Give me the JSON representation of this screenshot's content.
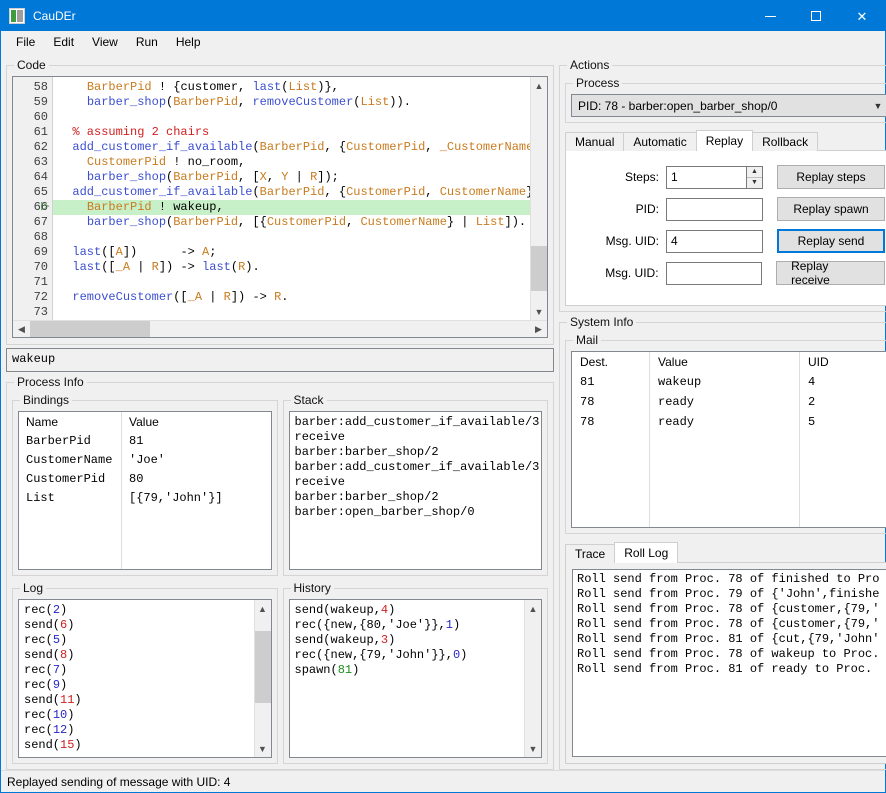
{
  "window": {
    "title": "CauDEr",
    "icon": "app-icon",
    "minimize": "–",
    "maximize": "□",
    "close": "✕"
  },
  "menubar": {
    "items": [
      "File",
      "Edit",
      "View",
      "Run",
      "Help"
    ]
  },
  "code_panel": {
    "title": "Code",
    "current_line": 66,
    "lines": [
      {
        "num": "58",
        "tokens": [
          {
            "t": "    ",
            "c": "pun"
          },
          {
            "t": "BarberPid",
            "c": "var"
          },
          {
            "t": " ! {",
            "c": "pun"
          },
          {
            "t": "customer",
            "c": "atom"
          },
          {
            "t": ", ",
            "c": "pun"
          },
          {
            "t": "last",
            "c": "fn"
          },
          {
            "t": "(",
            "c": "pun"
          },
          {
            "t": "List",
            "c": "var"
          },
          {
            "t": ")},",
            "c": "pun"
          }
        ]
      },
      {
        "num": "59",
        "tokens": [
          {
            "t": "    ",
            "c": "pun"
          },
          {
            "t": "barber_shop",
            "c": "fn"
          },
          {
            "t": "(",
            "c": "pun"
          },
          {
            "t": "BarberPid",
            "c": "var"
          },
          {
            "t": ", ",
            "c": "pun"
          },
          {
            "t": "removeCustomer",
            "c": "fn"
          },
          {
            "t": "(",
            "c": "pun"
          },
          {
            "t": "List",
            "c": "var"
          },
          {
            "t": ")).",
            "c": "pun"
          }
        ]
      },
      {
        "num": "60",
        "tokens": []
      },
      {
        "num": "61",
        "tokens": [
          {
            "t": "  % assuming 2 chairs",
            "c": "com"
          }
        ]
      },
      {
        "num": "62",
        "tokens": [
          {
            "t": "  ",
            "c": "pun"
          },
          {
            "t": "add_customer_if_available",
            "c": "fn"
          },
          {
            "t": "(",
            "c": "pun"
          },
          {
            "t": "BarberPid",
            "c": "var"
          },
          {
            "t": ", {",
            "c": "pun"
          },
          {
            "t": "CustomerPid",
            "c": "var"
          },
          {
            "t": ", ",
            "c": "pun"
          },
          {
            "t": "_CustomerName",
            "c": "var"
          },
          {
            "t": "}, [",
            "c": "pun"
          }
        ]
      },
      {
        "num": "63",
        "tokens": [
          {
            "t": "    ",
            "c": "pun"
          },
          {
            "t": "CustomerPid",
            "c": "var"
          },
          {
            "t": " ! ",
            "c": "pun"
          },
          {
            "t": "no_room",
            "c": "atom"
          },
          {
            "t": ",",
            "c": "pun"
          }
        ]
      },
      {
        "num": "64",
        "tokens": [
          {
            "t": "    ",
            "c": "pun"
          },
          {
            "t": "barber_shop",
            "c": "fn"
          },
          {
            "t": "(",
            "c": "pun"
          },
          {
            "t": "BarberPid",
            "c": "var"
          },
          {
            "t": ", [",
            "c": "pun"
          },
          {
            "t": "X",
            "c": "var"
          },
          {
            "t": ", ",
            "c": "pun"
          },
          {
            "t": "Y",
            "c": "var"
          },
          {
            "t": " | ",
            "c": "pun"
          },
          {
            "t": "R",
            "c": "var"
          },
          {
            "t": "]);",
            "c": "pun"
          }
        ]
      },
      {
        "num": "65",
        "tokens": [
          {
            "t": "  ",
            "c": "pun"
          },
          {
            "t": "add_customer_if_available",
            "c": "fn"
          },
          {
            "t": "(",
            "c": "pun"
          },
          {
            "t": "BarberPid",
            "c": "var"
          },
          {
            "t": ", {",
            "c": "pun"
          },
          {
            "t": "CustomerPid",
            "c": "var"
          },
          {
            "t": ", ",
            "c": "pun"
          },
          {
            "t": "CustomerName",
            "c": "var"
          },
          {
            "t": "}, ",
            "c": "pun"
          },
          {
            "t": "Li",
            "c": "var"
          }
        ]
      },
      {
        "num": "66",
        "highlight": true,
        "marker": true,
        "tokens": [
          {
            "t": "    ",
            "c": "pun"
          },
          {
            "t": "BarberPid",
            "c": "var"
          },
          {
            "t": " ! ",
            "c": "pun"
          },
          {
            "t": "wakeup",
            "c": "atom"
          },
          {
            "t": ",",
            "c": "pun"
          }
        ]
      },
      {
        "num": "67",
        "tokens": [
          {
            "t": "    ",
            "c": "pun"
          },
          {
            "t": "barber_shop",
            "c": "fn"
          },
          {
            "t": "(",
            "c": "pun"
          },
          {
            "t": "BarberPid",
            "c": "var"
          },
          {
            "t": ", [{",
            "c": "pun"
          },
          {
            "t": "CustomerPid",
            "c": "var"
          },
          {
            "t": ", ",
            "c": "pun"
          },
          {
            "t": "CustomerName",
            "c": "var"
          },
          {
            "t": "} | ",
            "c": "pun"
          },
          {
            "t": "List",
            "c": "var"
          },
          {
            "t": "]).",
            "c": "pun"
          }
        ]
      },
      {
        "num": "68",
        "tokens": []
      },
      {
        "num": "69",
        "tokens": [
          {
            "t": "  ",
            "c": "pun"
          },
          {
            "t": "last",
            "c": "fn"
          },
          {
            "t": "([",
            "c": "pun"
          },
          {
            "t": "A",
            "c": "var"
          },
          {
            "t": "])      -> ",
            "c": "pun"
          },
          {
            "t": "A",
            "c": "var"
          },
          {
            "t": ";",
            "c": "pun"
          }
        ]
      },
      {
        "num": "70",
        "tokens": [
          {
            "t": "  ",
            "c": "pun"
          },
          {
            "t": "last",
            "c": "fn"
          },
          {
            "t": "([",
            "c": "pun"
          },
          {
            "t": "_A",
            "c": "var"
          },
          {
            "t": " | ",
            "c": "pun"
          },
          {
            "t": "R",
            "c": "var"
          },
          {
            "t": "]) -> ",
            "c": "pun"
          },
          {
            "t": "last",
            "c": "fn"
          },
          {
            "t": "(",
            "c": "pun"
          },
          {
            "t": "R",
            "c": "var"
          },
          {
            "t": ").",
            "c": "pun"
          }
        ]
      },
      {
        "num": "71",
        "tokens": []
      },
      {
        "num": "72",
        "tokens": [
          {
            "t": "  ",
            "c": "pun"
          },
          {
            "t": "removeCustomer",
            "c": "fn"
          },
          {
            "t": "([",
            "c": "pun"
          },
          {
            "t": "_A",
            "c": "var"
          },
          {
            "t": " | ",
            "c": "pun"
          },
          {
            "t": "R",
            "c": "var"
          },
          {
            "t": "]) -> ",
            "c": "pun"
          },
          {
            "t": "R",
            "c": "var"
          },
          {
            "t": ".",
            "c": "pun"
          }
        ]
      },
      {
        "num": "73",
        "tokens": []
      }
    ]
  },
  "expression": {
    "value": "wakeup"
  },
  "process_info": {
    "title": "Process Info",
    "bindings": {
      "title": "Bindings",
      "columns": [
        "Name",
        "Value"
      ],
      "rows": [
        [
          "BarberPid",
          "81"
        ],
        [
          "CustomerName",
          "'Joe'"
        ],
        [
          "CustomerPid",
          "80"
        ],
        [
          "List",
          "[{79,'John'}]"
        ]
      ]
    },
    "stack": {
      "title": "Stack",
      "lines": [
        "barber:add_customer_if_available/3",
        "receive",
        "barber:barber_shop/2",
        "barber:add_customer_if_available/3",
        "receive",
        "barber:barber_shop/2",
        "barber:open_barber_shop/0"
      ]
    },
    "log": {
      "title": "Log",
      "entries": [
        {
          "kind": "rec",
          "arg": "2"
        },
        {
          "kind": "send",
          "arg": "6"
        },
        {
          "kind": "rec",
          "arg": "5"
        },
        {
          "kind": "send",
          "arg": "8"
        },
        {
          "kind": "rec",
          "arg": "7"
        },
        {
          "kind": "rec",
          "arg": "9"
        },
        {
          "kind": "send",
          "arg": "11"
        },
        {
          "kind": "rec",
          "arg": "10"
        },
        {
          "kind": "rec",
          "arg": "12"
        },
        {
          "kind": "send",
          "arg": "15"
        }
      ]
    },
    "history": {
      "title": "History",
      "entries": [
        {
          "kind": "send",
          "pre": "send(wakeup,",
          "arg": "4",
          "post": ")"
        },
        {
          "kind": "rec",
          "pre": "rec({new,{80,'Joe'}},",
          "arg": "1",
          "post": ")"
        },
        {
          "kind": "send",
          "pre": "send(wakeup,",
          "arg": "3",
          "post": ")"
        },
        {
          "kind": "rec",
          "pre": "rec({new,{79,'John'}},",
          "arg": "0",
          "post": ")"
        },
        {
          "kind": "spawn",
          "pre": "spawn(",
          "arg": "81",
          "post": ")"
        }
      ]
    }
  },
  "actions": {
    "title": "Actions",
    "process": {
      "title": "Process",
      "selected": "PID: 78 - barber:open_barber_shop/0",
      "arrow": "⌄"
    },
    "tabs": [
      {
        "label": "Manual",
        "active": false
      },
      {
        "label": "Automatic",
        "active": false
      },
      {
        "label": "Replay",
        "active": true
      },
      {
        "label": "Rollback",
        "active": false
      }
    ],
    "replay": {
      "rows": [
        {
          "label": "Steps:",
          "value": "1",
          "placeholder": "",
          "spinner": true,
          "button": "Replay steps",
          "focused": false
        },
        {
          "label": "PID:",
          "value": "",
          "placeholder": "",
          "spinner": false,
          "button": "Replay spawn",
          "focused": false
        },
        {
          "label": "Msg. UID:",
          "value": "4",
          "placeholder": "",
          "spinner": false,
          "button": "Replay send",
          "focused": true
        },
        {
          "label": "Msg. UID:",
          "value": "",
          "placeholder": "",
          "spinner": false,
          "button": "Replay receive",
          "focused": false
        }
      ]
    }
  },
  "system_info": {
    "title": "System Info",
    "mail": {
      "title": "Mail",
      "columns": [
        "Dest.",
        "Value",
        "UID"
      ],
      "rows": [
        [
          "81",
          "wakeup",
          "4"
        ],
        [
          "78",
          "ready",
          "2"
        ],
        [
          "78",
          "ready",
          "5"
        ]
      ]
    },
    "log_tabs": [
      {
        "label": "Trace",
        "active": false
      },
      {
        "label": "Roll Log",
        "active": true
      }
    ],
    "roll_log": {
      "lines": [
        "Roll send from Proc. 78 of finished to Pro",
        "Roll send from Proc. 79 of {'John',finishe",
        "Roll send from Proc. 78 of {customer,{79,'",
        "Roll send from Proc. 78 of {customer,{79,'",
        "Roll send from Proc. 81 of {cut,{79,'John'",
        "Roll send from Proc. 78 of wakeup to Proc.",
        "Roll send from Proc. 81 of ready to Proc."
      ]
    }
  },
  "statusbar": {
    "text": "Replayed sending of message with UID: 4"
  },
  "colors": {
    "accent": "#0078d7",
    "highlight_line": "#c8f0c8",
    "marker": "#3d9c3d",
    "function": "#3b4fcf",
    "variable": "#c97b1e",
    "comment": "#d02020",
    "log_rec": "#2626c8",
    "log_send": "#d02020",
    "log_spawn": "#1e8c1e"
  }
}
